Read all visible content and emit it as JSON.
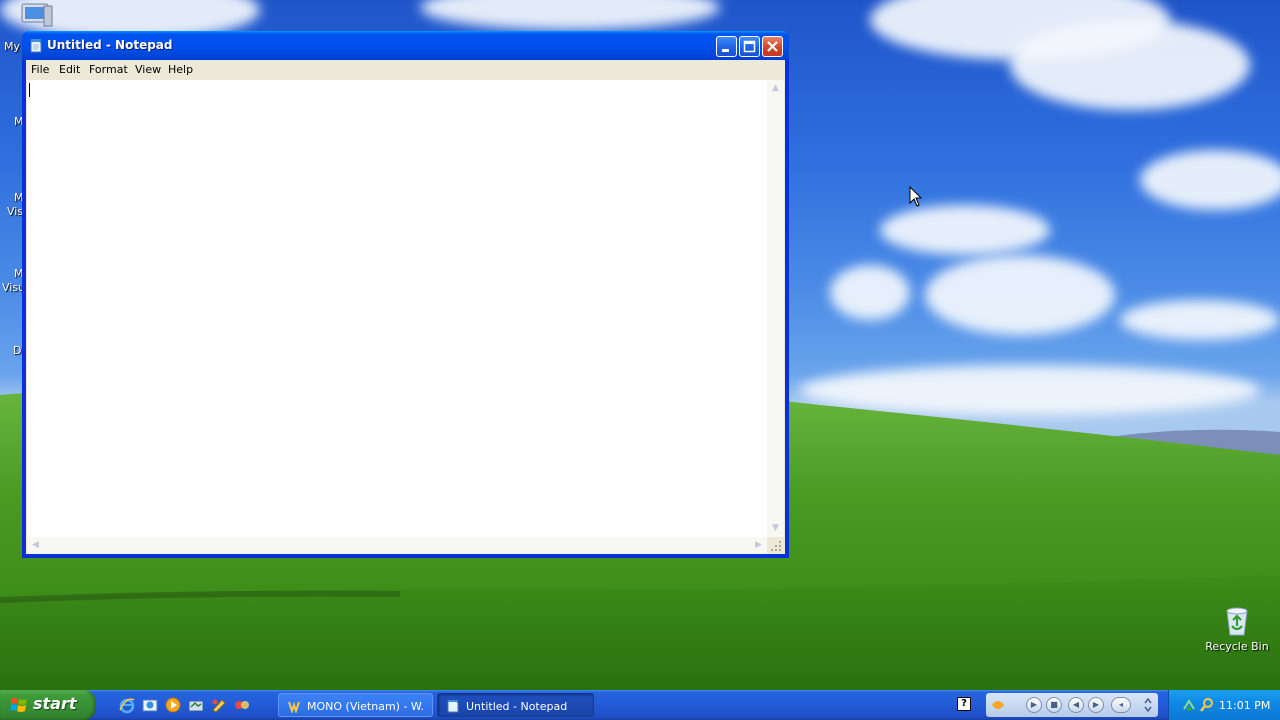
{
  "desktop": {
    "left_fragments": [
      "My",
      "M",
      "M",
      "Visi",
      "M",
      "Visu",
      "D"
    ],
    "icons": [
      {
        "label": "Recycle Bin",
        "icon": "recycle-bin-icon"
      }
    ]
  },
  "notepad": {
    "title": "Untitled - Notepad",
    "icon": "notepad-icon",
    "menu": [
      "File",
      "Edit",
      "Format",
      "View",
      "Help"
    ],
    "content": ""
  },
  "taskbar": {
    "start_label": "start",
    "quick_launch": [
      "internet-explorer-icon",
      "outlook-express-icon",
      "media-player-icon",
      "show-desktop-icon",
      "paint-icon",
      "app-icon"
    ],
    "tasks": [
      {
        "label": "MONO (Vietnam) - W...",
        "icon": "winamp-icon",
        "active": false
      },
      {
        "label": "Untitled - Notepad",
        "icon": "notepad-icon",
        "active": true
      }
    ],
    "help_glyph": "?",
    "media_controls": [
      "play",
      "stop",
      "previous",
      "next",
      "volume"
    ],
    "tray_icons": [
      "network-icon",
      "search-icon"
    ],
    "clock": "11:01 PM"
  },
  "colors": {
    "titlebar": "#0053ee",
    "taskbar": "#245edb",
    "start_button": "#388e35",
    "tray": "#0f8ae6"
  }
}
